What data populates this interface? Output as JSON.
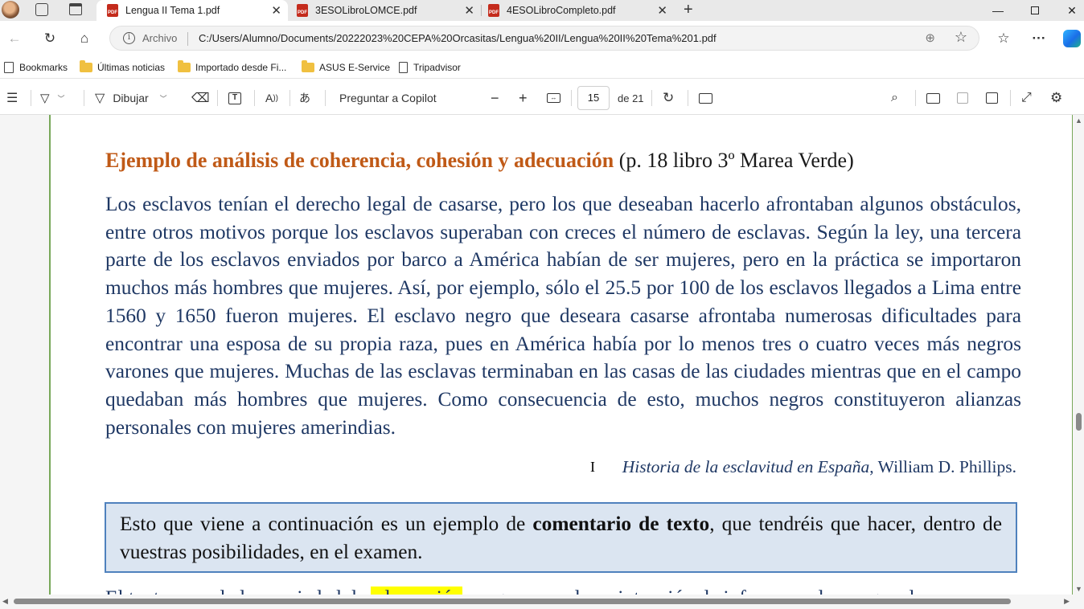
{
  "tabs": [
    {
      "title": "Lengua II Tema 1.pdf",
      "active": true
    },
    {
      "title": "3ESOLibroLOMCE.pdf",
      "active": false
    },
    {
      "title": "4ESOLibroCompleto.pdf",
      "active": false
    }
  ],
  "address": {
    "scheme_label": "Archivo",
    "url": "C:/Users/Alumno/Documents/20222023%20CEPA%20Orcasitas/Lengua%20II/Lengua%20II%20Tema%201.pdf"
  },
  "bookmarks": [
    {
      "label": "Bookmarks",
      "icon": "bookmark-icon"
    },
    {
      "label": "Últimas noticias",
      "icon": "folder-icon"
    },
    {
      "label": "Importado desde Fi...",
      "icon": "folder-icon"
    },
    {
      "label": "ASUS E-Service",
      "icon": "folder-icon"
    },
    {
      "label": "Tripadvisor",
      "icon": "page-icon"
    }
  ],
  "pdf_toolbar": {
    "draw_label": "Dibujar",
    "copilot_label": "Preguntar a Copilot",
    "page_current": "15",
    "page_total": "de 21"
  },
  "document": {
    "heading_colored": "Ejemplo de análisis de coherencia, cohesión y adecuación",
    "heading_rest": " (p. 18 libro 3º Marea Verde)",
    "paragraph": "Los esclavos tenían el derecho legal de casarse, pero los que deseaban hacerlo afrontaban algunos obstáculos, entre otros motivos porque los esclavos superaban con creces el número de esclavas. Según la ley, una tercera parte de los esclavos enviados por barco a América habían de ser mujeres, pero en la práctica se importaron muchos más hombres que mujeres. Así, por ejemplo, sólo el 25.5 por 100 de los esclavos llegados a Lima entre 1560 y 1650 fueron mujeres. El esclavo negro que deseara casarse afrontaba numerosas dificultades para encontrar una esposa de su propia raza, pues en América había por lo menos tres o cuatro veces más negros varones que mujeres. Muchas de las esclavas terminaban en las casas de las ciudades mientras que en el campo quedaban más hombres que mujeres. Como consecuencia de esto, muchos negros constituyeron alianzas personales con mujeres amerindias.",
    "source_title": "Historia de la esclavitud en España",
    "source_author": ", William D. Phillips.",
    "note_before": "Esto que viene a continuación es un ejemplo de ",
    "note_bold": "comentario de texto",
    "note_after": ", que tendréis que hacer, dentro de vuestras posibilidades, en el examen.",
    "next_before": "El texto cumple la propiedad de ",
    "next_highlight": "adecuación",
    "next_after": " porque cumple su intención de informar, a la par que de"
  }
}
